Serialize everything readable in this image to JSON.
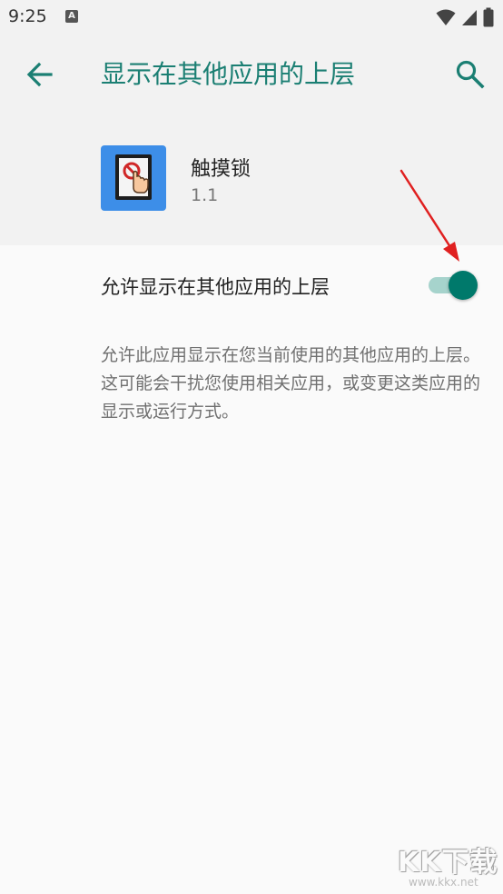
{
  "status_bar": {
    "time": "9:25",
    "notification_icon": "a-icon",
    "icons": [
      "wifi-icon",
      "signal-icon",
      "battery-icon"
    ]
  },
  "header": {
    "title": "显示在其他应用的上层",
    "back_icon": "arrow-left-icon",
    "search_icon": "search-icon"
  },
  "app": {
    "name": "触摸锁",
    "version": "1.1",
    "icon": "touch-lock-app-icon"
  },
  "permission": {
    "label": "允许显示在其他应用的上层",
    "enabled": true,
    "description": "允许此应用显示在您当前使用的其他应用的上层。这可能会干扰您使用相关应用，或变更这类应用的显示或运行方式。"
  },
  "watermark": {
    "brand": "KK下载",
    "url": "www.kkx.net"
  },
  "colors": {
    "accent": "#1b7f73",
    "switch_thumb": "#00796b",
    "switch_track": "#a6d3cc",
    "header_bg": "#f2f2f2",
    "content_bg": "#fafafa",
    "annotation_arrow": "#e02020"
  }
}
